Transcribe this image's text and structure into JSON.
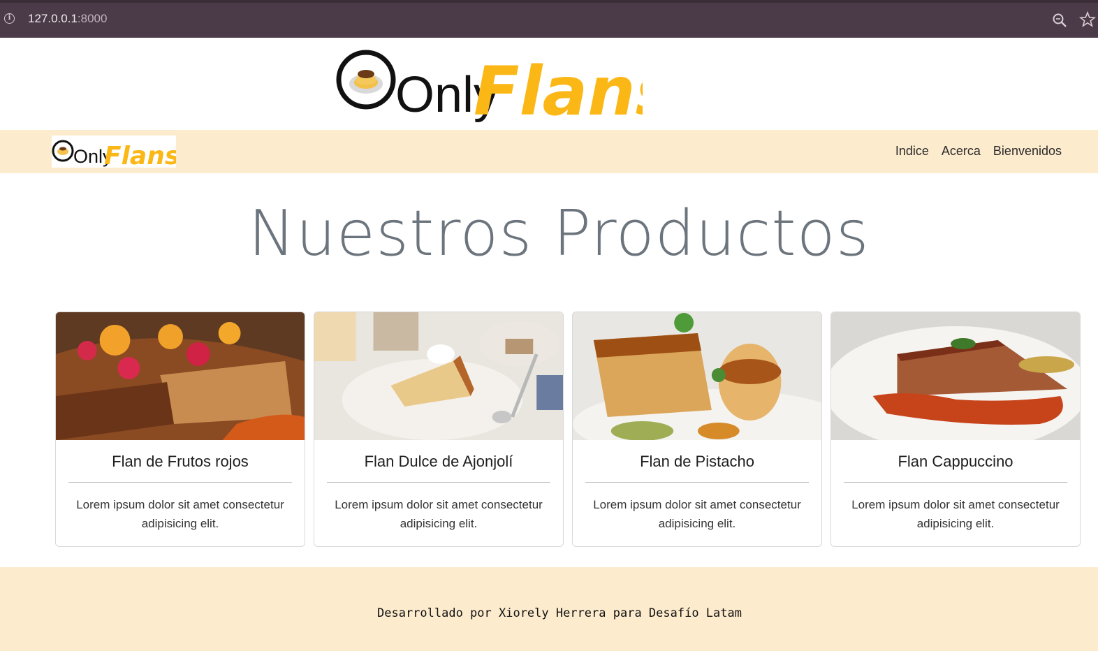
{
  "browser": {
    "url_host": "127.0.0.1",
    "url_port": ":8000",
    "icons": [
      "info-icon",
      "zoom-icon",
      "star-icon"
    ]
  },
  "brand": {
    "name_part1": "Only",
    "name_part2": "Flans",
    "accent_color": "#fbb716",
    "dark_color": "#111111"
  },
  "nav": {
    "items": [
      {
        "label": "Indice"
      },
      {
        "label": "Acerca"
      },
      {
        "label": "Bienvenidos"
      }
    ],
    "background": "#fdebcd"
  },
  "main": {
    "title": "Nuestros Productos",
    "cards": [
      {
        "title": "Flan de Frutos rojos",
        "text": "Lorem ipsum dolor sit amet consectetur adipisicing elit."
      },
      {
        "title": "Flan Dulce de Ajonjolí",
        "text": "Lorem ipsum dolor sit amet consectetur adipisicing elit."
      },
      {
        "title": "Flan de Pistacho",
        "text": "Lorem ipsum dolor sit amet consectetur adipisicing elit."
      },
      {
        "title": "Flan Cappuccino",
        "text": "Lorem ipsum dolor sit amet consectetur adipisicing elit."
      }
    ]
  },
  "footer": {
    "text": "Desarrollado por Xiorely Herrera para Desafío Latam"
  }
}
